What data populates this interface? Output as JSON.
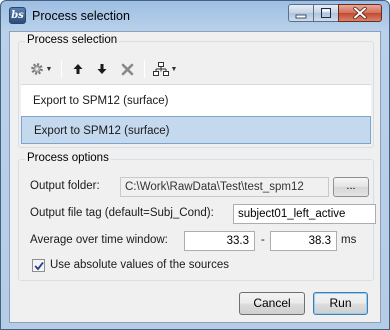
{
  "window": {
    "title": "Process selection",
    "app_icon": "bs"
  },
  "process_selection": {
    "group_label": "Process selection",
    "toolbar": {
      "icons": [
        "gear-icon",
        "move-up-icon",
        "move-down-icon",
        "delete-icon",
        "pipeline-tree-icon"
      ]
    },
    "items": [
      {
        "label": "Export to SPM12 (surface)",
        "selected": false
      },
      {
        "label": "Export to SPM12 (surface)",
        "selected": true
      }
    ]
  },
  "process_options": {
    "group_label": "Process options",
    "output_folder": {
      "label": "Output folder:",
      "value": "C:\\Work\\RawData\\Test\\test_spm12",
      "browse_label": "..."
    },
    "output_file_tag": {
      "label": "Output file tag (default=Subj_Cond):",
      "value": "subject01_left_active"
    },
    "time_window": {
      "label": "Average over time window:",
      "start": "33.3",
      "separator": "-",
      "end": "38.3",
      "unit": "ms"
    },
    "absolute_values": {
      "label": "Use absolute values of the sources",
      "checked": true
    }
  },
  "buttons": {
    "cancel": "Cancel",
    "run": "Run"
  }
}
